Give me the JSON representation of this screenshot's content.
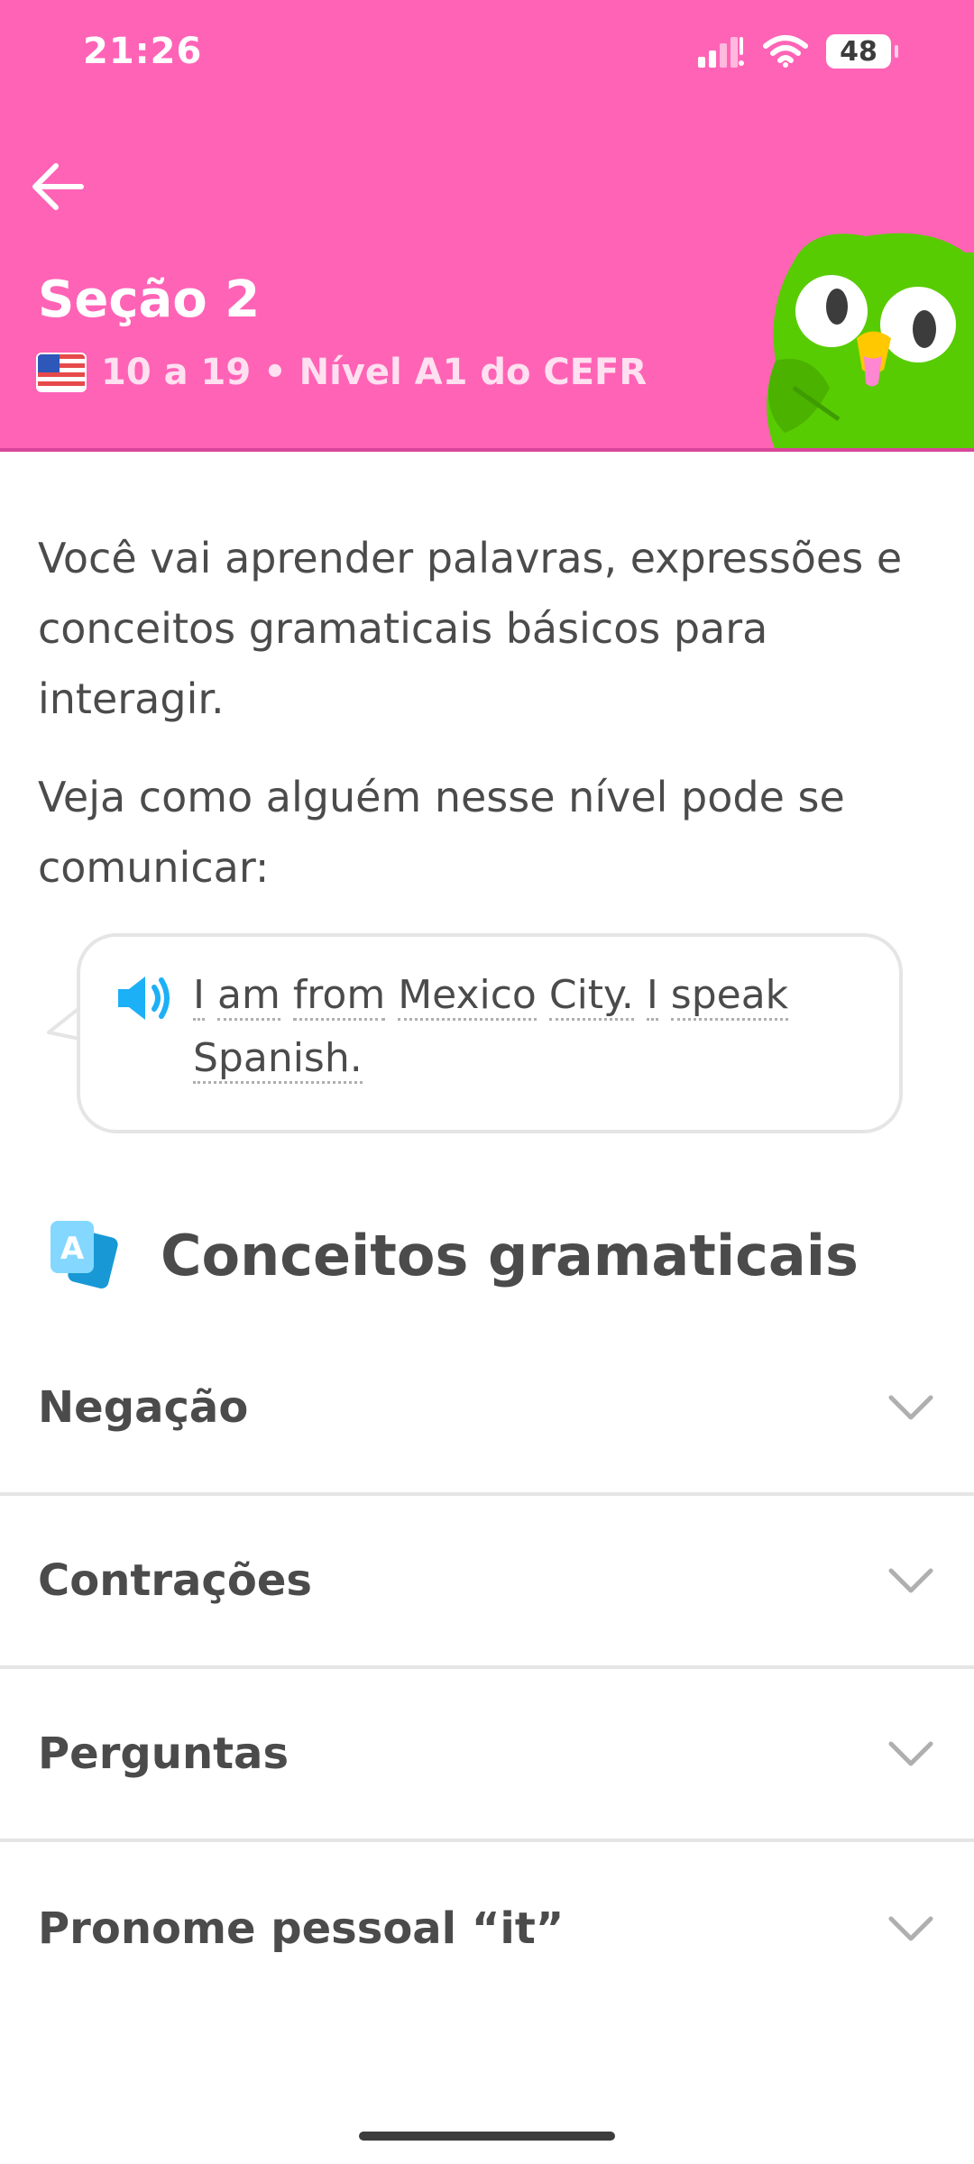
{
  "status_bar": {
    "time": "21:26",
    "battery": "48"
  },
  "header": {
    "title": "Seção 2",
    "subtitle": "10 a 19 • Nível A1 do CEFR",
    "background_color": "#ff63b6"
  },
  "content": {
    "intro": "Você vai aprender palavras, expressões e conceitos gramaticais básicos para interagir.",
    "example_intro": "Veja como alguém nesse nível pode se comunicar:",
    "example_words": [
      "I",
      "am",
      "from",
      "Mexico",
      "City.",
      "I",
      "speak",
      "Spanish."
    ]
  },
  "grammar": {
    "title": "Conceitos gramaticais",
    "icon_letter": "A",
    "topics": [
      {
        "label": "Negação"
      },
      {
        "label": "Contrações"
      },
      {
        "label": "Perguntas"
      },
      {
        "label": "Pronome pessoal “it”"
      }
    ]
  }
}
